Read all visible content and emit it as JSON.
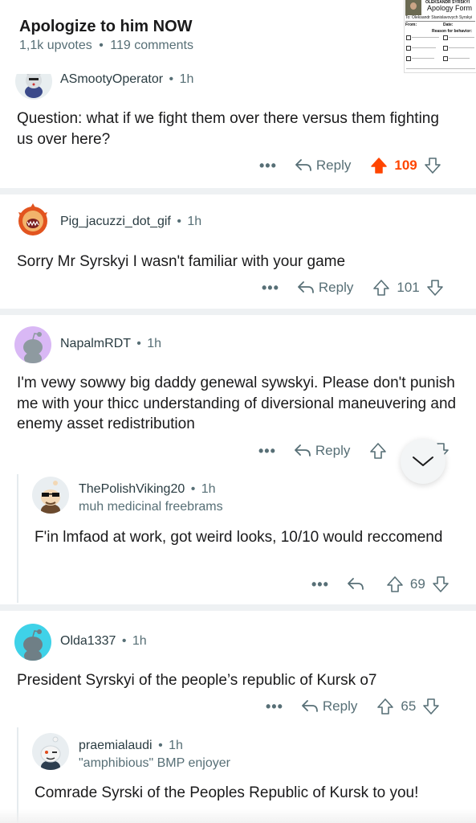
{
  "post": {
    "title": "Apologize to him NOW",
    "upvotes": "1,1k upvotes",
    "separator": "•",
    "comments": "119 comments"
  },
  "thumbnail": {
    "header": "OLEKSANDR SYRSKYI",
    "title": "Apology Form",
    "to_line": "To: Oleksandr Stanislavovych Syrskyi",
    "from_label": "From:",
    "date_label": "Date:",
    "reason_label": "Reason for behavior:"
  },
  "actions": {
    "more": "•••",
    "reply": "Reply"
  },
  "comments": [
    {
      "username": "ASmootyOperator",
      "time": "1h",
      "text": "Question: what if we fight them over there versus them fighting us over here?",
      "votes": "109",
      "upvoted": true
    },
    {
      "username": "Pig_jacuzzi_dot_gif",
      "time": "1h",
      "text": "Sorry Mr Syrskyi I wasn't familiar with your game",
      "votes": "101"
    },
    {
      "username": "NapalmRDT",
      "time": "1h",
      "text": "I'm vewy sowwy big daddy genewal sywskyi. Please don't punish me with your thicc understanding of diversional maneuvering and enemy asset redistribution"
    },
    {
      "username": "ThePolishViking20",
      "time": "1h",
      "flair": "muh medicinal freebrams",
      "text": "F'in lmfaod at work, got weird looks, 10/10 would reccomend",
      "votes": "69"
    },
    {
      "username": "Olda1337",
      "time": "1h",
      "text": "President Syrskyi of the people’s republic of Kursk o7",
      "votes": "65"
    },
    {
      "username": "praemialaudi",
      "time": "1h",
      "flair": "\"amphibious\" BMP enjoyer",
      "text": "Comrade Syrski of the Peoples Republic of Kursk to you!"
    }
  ],
  "colors": {
    "upvote_active": "#ff4500",
    "meta_gray": "#576f76",
    "divider": "#eef1f3"
  },
  "icons": [
    "reply-arrow-icon",
    "upvote-arrow-icon",
    "downvote-arrow-icon",
    "chevron-down-icon"
  ]
}
